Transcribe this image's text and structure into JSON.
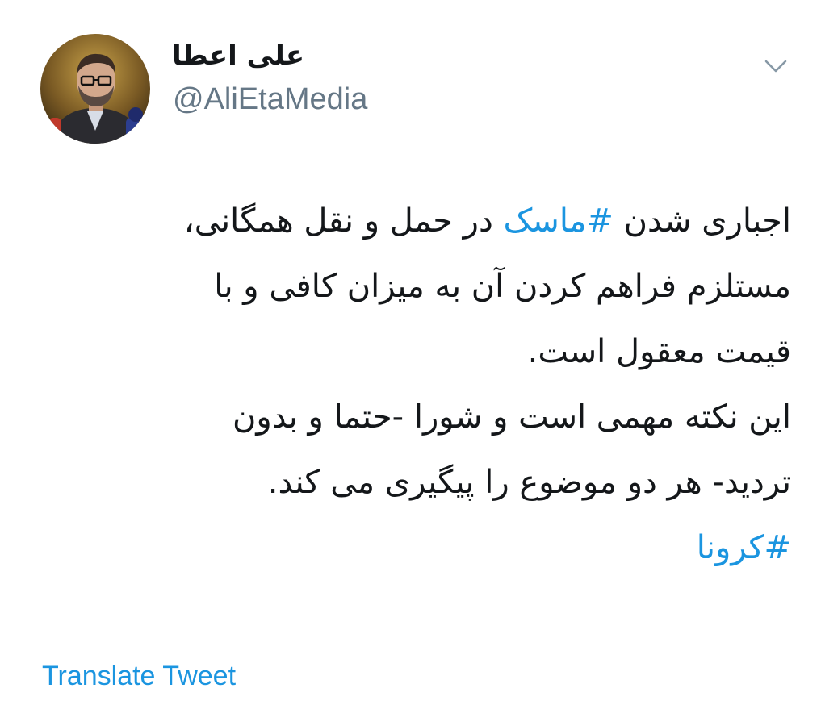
{
  "author": {
    "display_name": "علی اعطا",
    "handle": "@AliEtaMedia"
  },
  "icons": {
    "avatar": "profile-photo",
    "menu": "chevron-down-icon"
  },
  "tweet": {
    "line1_before": "اجباری شدن ",
    "line1_hashtag": "#ماسک",
    "line1_after": " در حمل و نقل همگانی،",
    "line2": "مستلزم فراهم کردن آن به میزان کافی و با",
    "line3": "قیمت معقول است.",
    "line4": "این نکته مهمی است و شورا -حتما و بدون",
    "line5": "تردید- هر دو موضوع را پیگیری می کند.",
    "line6_hashtag": "#کرونا"
  },
  "translate_label": "Translate Tweet",
  "colors": {
    "link": "#1b95e0",
    "handle": "#657786",
    "text": "#14171a"
  }
}
